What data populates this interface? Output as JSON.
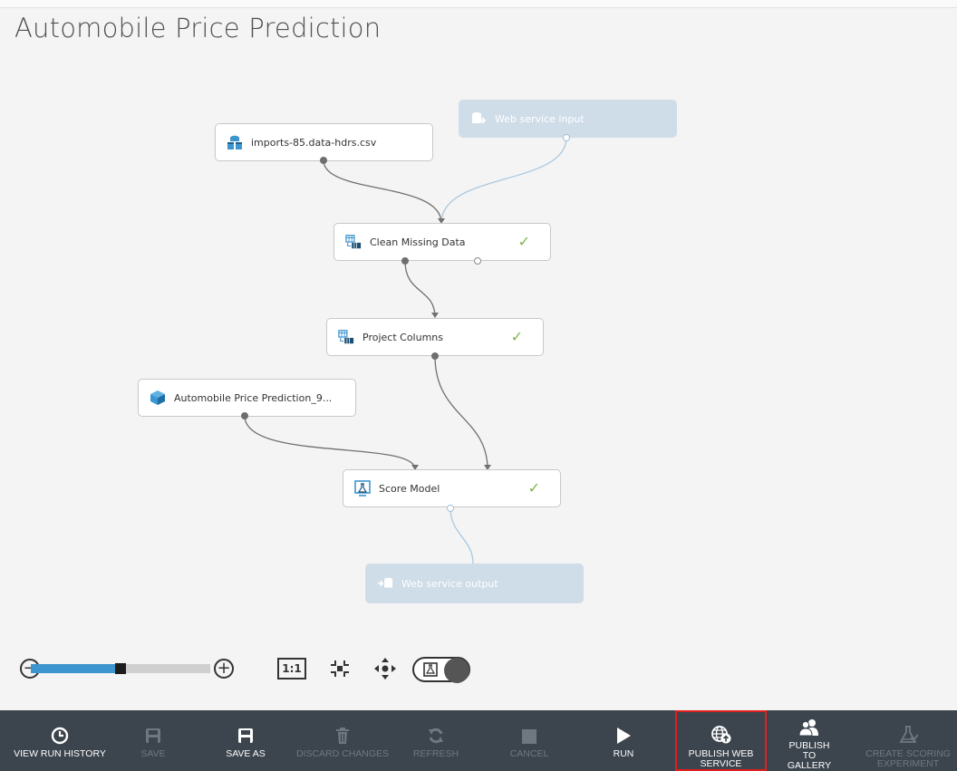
{
  "page": {
    "title": "Automobile Price Prediction"
  },
  "canvas": {
    "nodes": [
      {
        "id": "dataset",
        "label": "imports-85.data-hdrs.csv",
        "icon": "dataset-icon",
        "ghost": false,
        "check": false
      },
      {
        "id": "ws_input",
        "label": "Web service input",
        "icon": "web-service-input-icon",
        "ghost": true,
        "check": false
      },
      {
        "id": "clean",
        "label": "Clean Missing Data",
        "icon": "table-transform-icon",
        "ghost": false,
        "check": true
      },
      {
        "id": "project",
        "label": "Project Columns",
        "icon": "table-transform-icon",
        "ghost": false,
        "check": true
      },
      {
        "id": "model",
        "label": "Automobile Price Prediction_9...",
        "icon": "trained-model-icon",
        "ghost": false,
        "check": false
      },
      {
        "id": "score",
        "label": "Score Model",
        "icon": "score-model-icon",
        "ghost": false,
        "check": true
      },
      {
        "id": "ws_output",
        "label": "Web service output",
        "icon": "web-service-output-icon",
        "ghost": true,
        "check": false
      }
    ],
    "check_glyph": "✓"
  },
  "zoom": {
    "minus": "−",
    "plus": "+",
    "level": 0.47,
    "actual_size_label": "1:1"
  },
  "command_bar": {
    "items": [
      {
        "label": "VIEW RUN HISTORY",
        "icon": "clock-icon",
        "enabled": true,
        "highlighted": false
      },
      {
        "label": "SAVE",
        "icon": "save-icon",
        "enabled": false,
        "highlighted": false
      },
      {
        "label": "SAVE AS",
        "icon": "save-as-icon",
        "enabled": true,
        "highlighted": false
      },
      {
        "label": "DISCARD CHANGES",
        "icon": "trash-icon",
        "enabled": false,
        "highlighted": false
      },
      {
        "label": "REFRESH",
        "icon": "refresh-icon",
        "enabled": false,
        "highlighted": false
      },
      {
        "label": "CANCEL",
        "icon": "stop-icon",
        "enabled": false,
        "highlighted": false
      },
      {
        "label": "RUN",
        "icon": "play-icon",
        "enabled": true,
        "highlighted": false
      },
      {
        "label": "PUBLISH WEB SERVICE",
        "icon": "globe-upload-icon",
        "enabled": true,
        "highlighted": true
      },
      {
        "label": "PUBLISH TO GALLERY",
        "icon": "users-icon",
        "enabled": true,
        "highlighted": false
      },
      {
        "label": "CREATE SCORING EXPERIMENT",
        "icon": "flask-icon",
        "enabled": false,
        "highlighted": false
      }
    ]
  },
  "colors": {
    "accent": "#3d95cf",
    "success": "#7ab648",
    "highlight_border": "#e01f1f",
    "command_bar_bg": "#3c444d",
    "ghost_node_bg": "#cfdde9",
    "connector": "#707070",
    "ghost_connector": "#a9c9e0"
  }
}
